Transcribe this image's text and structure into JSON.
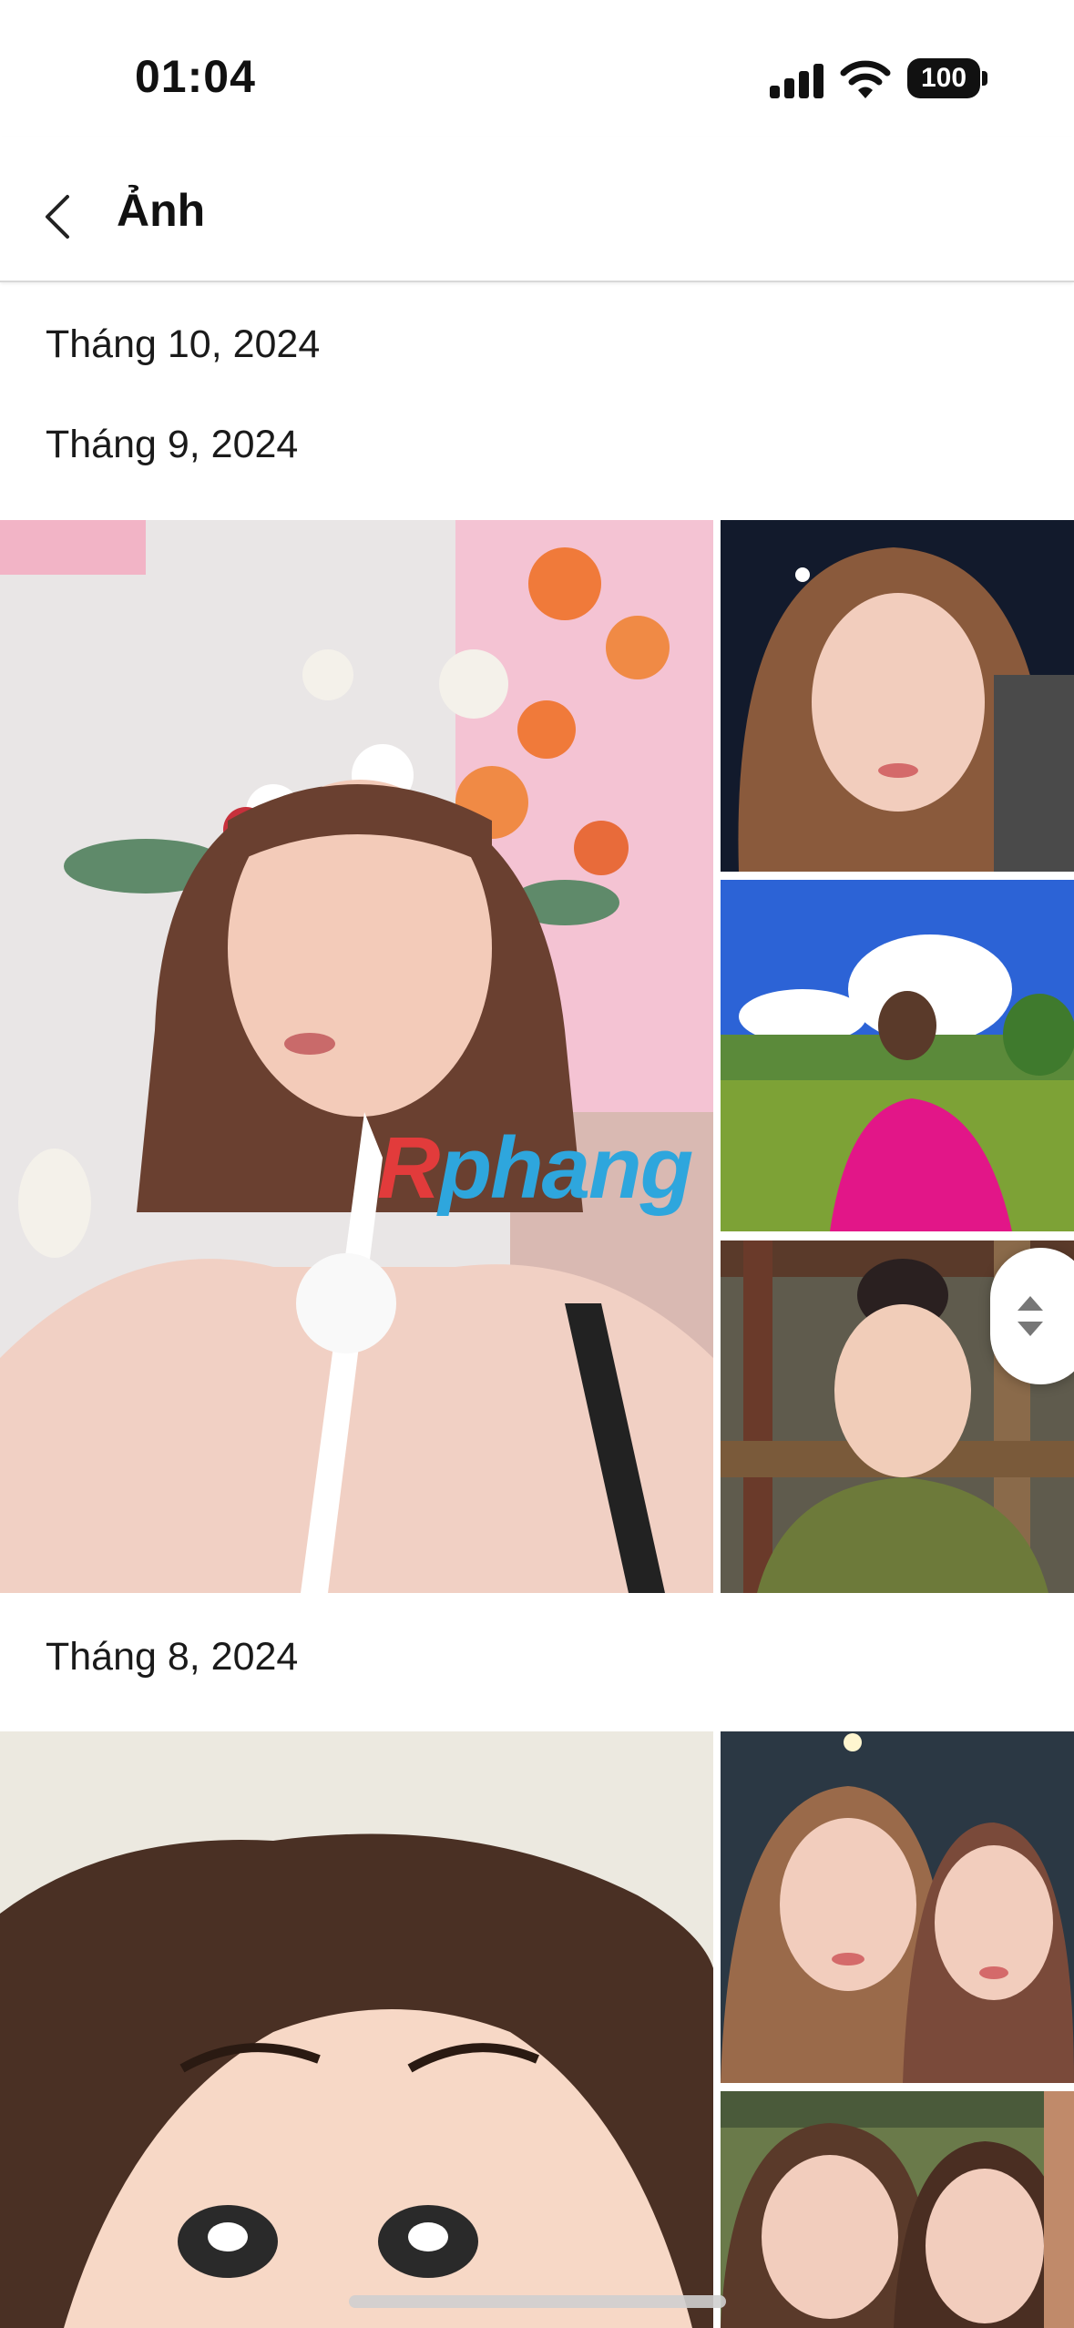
{
  "status_bar": {
    "time": "01:04",
    "battery": "100",
    "icons": [
      "signal-icon",
      "wifi-icon",
      "battery-icon"
    ]
  },
  "nav": {
    "title": "Ảnh",
    "back_icon": "chevron-left-icon"
  },
  "sections": [
    {
      "label": "Tháng 10, 2024"
    },
    {
      "label": "Tháng 9, 2024"
    },
    {
      "label": "Tháng 8, 2024"
    }
  ],
  "watermark": {
    "part1": "R",
    "part2": "phang"
  },
  "colors": {
    "accent_red": "#e23b3b",
    "accent_blue": "#2ea6dd",
    "divider": "#d8d8d8"
  }
}
